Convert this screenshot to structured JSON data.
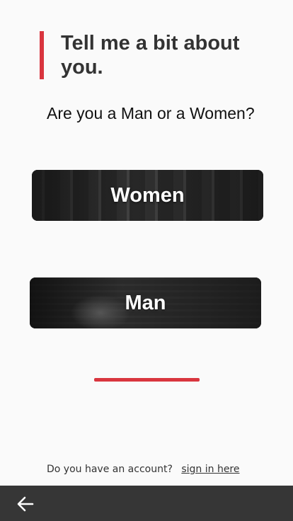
{
  "header": {
    "title": "Tell me a bit about you."
  },
  "question": {
    "text": "Are you a Man or a Women?"
  },
  "choices": {
    "women_label": "Women",
    "man_label": "Man"
  },
  "footer": {
    "account_text": "Do you have an account?",
    "signin_link": "sign in here"
  },
  "nav": {
    "back_icon": "arrow-left-icon"
  },
  "colors": {
    "accent": "#d9353e",
    "text_dark": "#333333",
    "bottom_bar": "#363636",
    "background": "#fafafa"
  }
}
